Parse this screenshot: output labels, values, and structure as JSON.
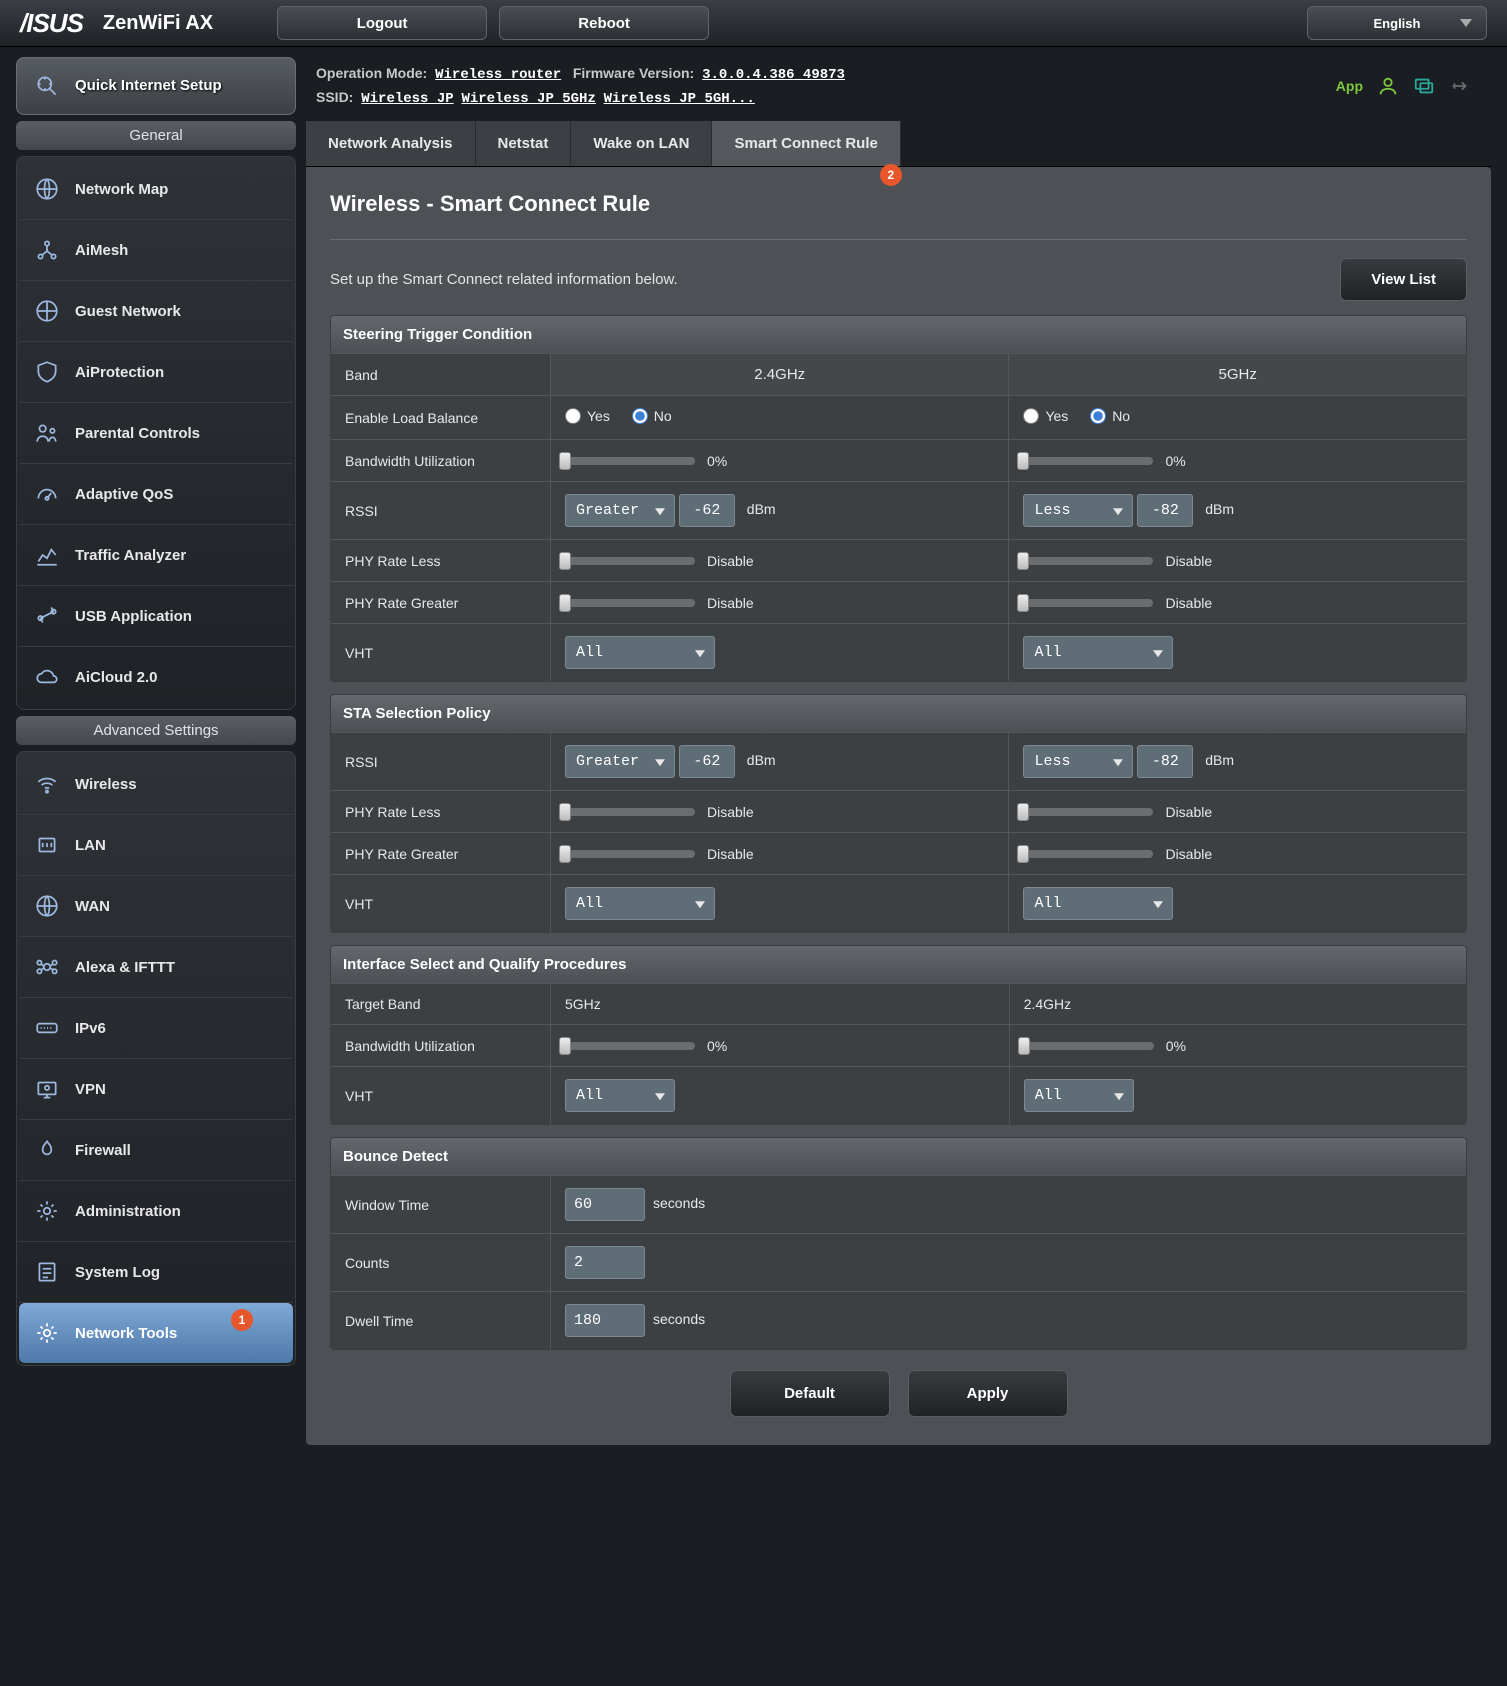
{
  "brand": {
    "logo": "/SUS",
    "model": "ZenWiFi AX"
  },
  "topbar": {
    "logout": "Logout",
    "reboot": "Reboot",
    "language": "English"
  },
  "info": {
    "opmode_label": "Operation Mode:",
    "opmode_val": "Wireless router",
    "fw_label": "Firmware Version:",
    "fw_val": "3.0.0.4.386_49873",
    "ssid_label": "SSID:",
    "ssid1": "Wireless JP",
    "ssid2": "Wireless JP 5GHz",
    "ssid3": "Wireless JP 5GH...",
    "app": "App"
  },
  "tabs": {
    "0": "Network Analysis",
    "1": "Netstat",
    "2": "Wake on LAN",
    "3": "Smart Connect Rule",
    "active": 3,
    "badge": "2"
  },
  "sidebar": {
    "quick": "Quick Internet Setup",
    "general_head": "General",
    "general": [
      "Network Map",
      "AiMesh",
      "Guest Network",
      "AiProtection",
      "Parental Controls",
      "Adaptive QoS",
      "Traffic Analyzer",
      "USB Application",
      "AiCloud 2.0"
    ],
    "advanced_head": "Advanced Settings",
    "advanced": [
      "Wireless",
      "LAN",
      "WAN",
      "Alexa & IFTTT",
      "IPv6",
      "VPN",
      "Firewall",
      "Administration",
      "System Log",
      "Network Tools"
    ],
    "selected": "Network Tools",
    "badge1": "1"
  },
  "page": {
    "title": "Wireless - Smart Connect Rule",
    "desc": "Set up the Smart Connect related information below.",
    "viewlist": "View List",
    "yes": "Yes",
    "no": "No",
    "dbm": "dBm",
    "seconds": "seconds",
    "sections": {
      "steer": {
        "head": "Steering Trigger Condition",
        "band_label": "Band",
        "band24": "2.4GHz",
        "band5": "5GHz",
        "rows": {
          "elb": "Enable Load Balance",
          "bw": "Bandwidth Utilization",
          "bw24": "0%",
          "bw5": "0%",
          "rssi": "RSSI",
          "rssi24_op": "Greater",
          "rssi24_v": "-62",
          "rssi5_op": "Less",
          "rssi5_v": "-82",
          "prl": "PHY Rate Less",
          "prl24": "Disable",
          "prl5": "Disable",
          "prg": "PHY Rate Greater",
          "prg24": "Disable",
          "prg5": "Disable",
          "vht": "VHT",
          "vht24": "All",
          "vht5": "All"
        }
      },
      "sta": {
        "head": "STA Selection Policy",
        "rows": {
          "rssi": "RSSI",
          "rssi24_op": "Greater",
          "rssi24_v": "-62",
          "rssi5_op": "Less",
          "rssi5_v": "-82",
          "prl": "PHY Rate Less",
          "prl24": "Disable",
          "prl5": "Disable",
          "prg": "PHY Rate Greater",
          "prg24": "Disable",
          "prg5": "Disable",
          "vht": "VHT",
          "vht24": "All",
          "vht5": "All"
        }
      },
      "iface": {
        "head": "Interface Select and Qualify Procedures",
        "rows": {
          "tb": "Target Band",
          "tb24": "5GHz",
          "tb5": "2.4GHz",
          "bw": "Bandwidth Utilization",
          "bw24": "0%",
          "bw5": "0%",
          "vht": "VHT",
          "vht24": "All",
          "vht5": "All"
        }
      },
      "bounce": {
        "head": "Bounce Detect",
        "rows": {
          "wt": "Window Time",
          "wt_v": "60",
          "cnt": "Counts",
          "cnt_v": "2",
          "dw": "Dwell Time",
          "dw_v": "180"
        }
      }
    },
    "default_btn": "Default",
    "apply_btn": "Apply"
  }
}
